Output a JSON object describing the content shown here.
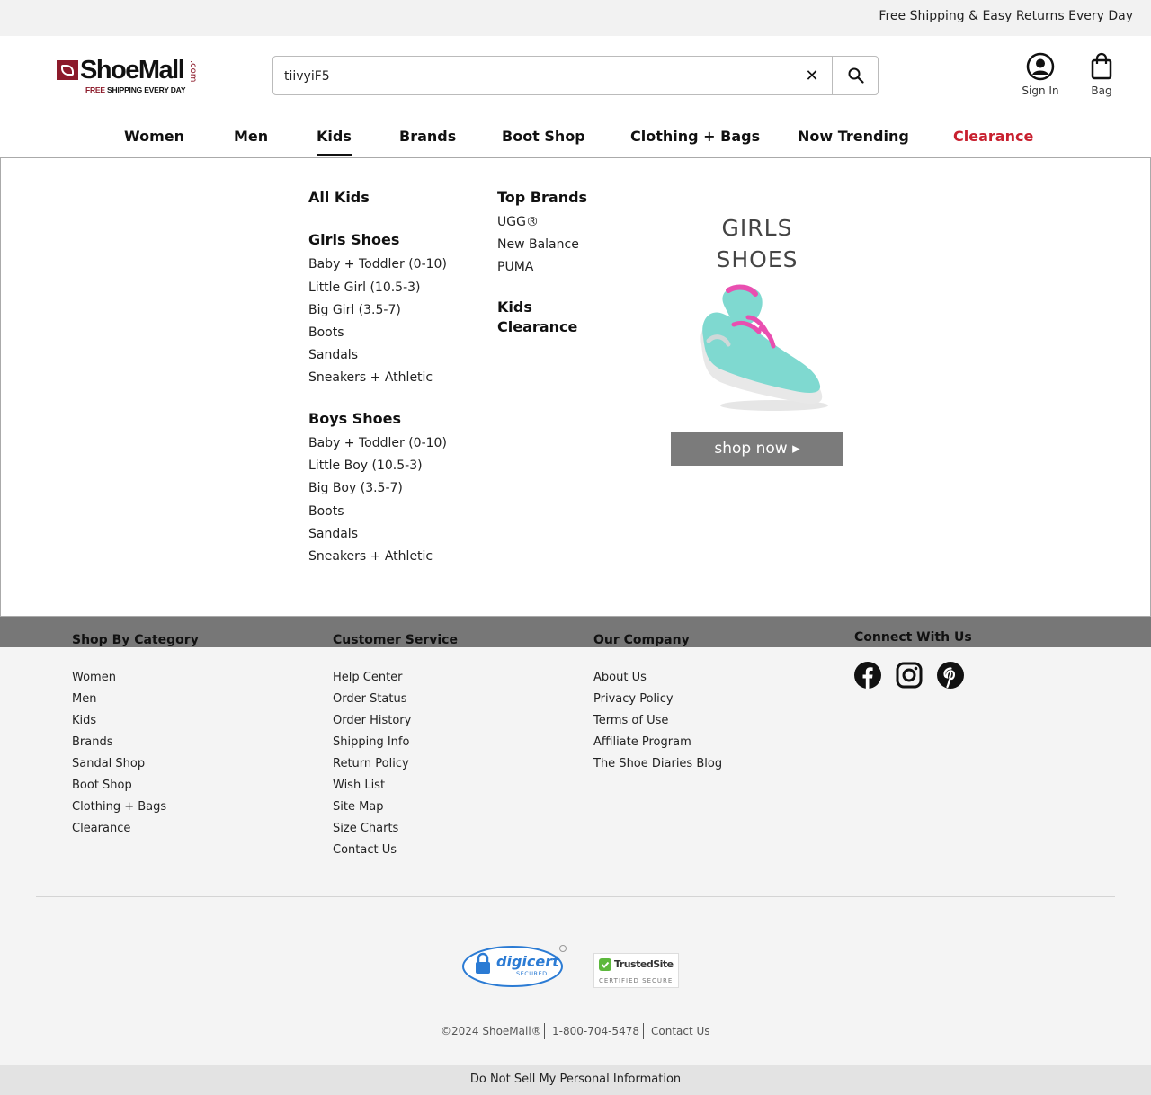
{
  "promo_bar": {
    "text": "Free Shipping & Easy Returns Every Day"
  },
  "header": {
    "logo_name": "ShoeMall",
    "logo_dotcom": ".com",
    "logo_tag_highlight": "FREE",
    "logo_tag_rest": " SHIPPING EVERY DAY",
    "search_value": "tiivyiF5",
    "sign_in_label": "Sign In",
    "bag_label": "Bag"
  },
  "nav": {
    "items": [
      {
        "label": "Women"
      },
      {
        "label": "Men"
      },
      {
        "label": "Kids",
        "active": true
      },
      {
        "label": "Brands"
      },
      {
        "label": "Boot Shop"
      },
      {
        "label": "Clothing + Bags"
      },
      {
        "label": "Now Trending"
      },
      {
        "label": "Clearance",
        "color": "#c8202f"
      }
    ]
  },
  "mega_menu": {
    "all_kids": "All Kids",
    "girls_heading": "Girls Shoes",
    "girls_links": [
      "Baby + Toddler (0-10)",
      "Little Girl (10.5-3)",
      "Big Girl (3.5-7)",
      "Boots",
      "Sandals",
      "Sneakers + Athletic"
    ],
    "boys_heading": "Boys Shoes",
    "boys_links": [
      "Baby + Toddler (0-10)",
      "Little Boy (10.5-3)",
      "Big Boy (3.5-7)",
      "Boots",
      "Sandals",
      "Sneakers + Athletic"
    ],
    "brands_heading": "Top Brands",
    "brand_links": [
      "UGG®",
      "New Balance",
      "PUMA"
    ],
    "clearance_line1": "Kids",
    "clearance_line2": "Clearance",
    "promo_title_line1": "GIRLS",
    "promo_title_line2": "SHOES",
    "promo_button": "shop now ▸",
    "accent_color": "#7b7b7b"
  },
  "footer": {
    "shop_by_category": {
      "heading": "Shop By Category",
      "links": [
        "Women",
        "Men",
        "Kids",
        "Brands",
        "Sandal Shop",
        "Boot Shop",
        "Clothing + Bags",
        "Clearance"
      ]
    },
    "customer_service": {
      "heading": "Customer Service",
      "links": [
        "Help Center",
        "Order Status",
        "Order History",
        "Shipping Info",
        "Return Policy",
        "Wish List",
        "Site Map",
        "Size Charts",
        "Contact Us"
      ]
    },
    "our_company": {
      "heading": "Our Company",
      "links": [
        "About Us",
        "Privacy Policy",
        "Terms of Use",
        "Affiliate Program",
        "The Shoe Diaries Blog"
      ]
    },
    "connect": {
      "heading": "Connect With Us",
      "icons": [
        "facebook-icon",
        "instagram-icon",
        "pinterest-icon"
      ]
    },
    "badges": {
      "digicert_name": "digicert",
      "digicert_sub": "SECURED",
      "trusted_name": "TrustedSite",
      "trusted_sub": "CERTIFIED SECURE"
    },
    "legal": {
      "copyright": "©2024 ShoeMall®",
      "phone": "1-800-704-5478",
      "contact": "Contact Us"
    },
    "do_not_sell": "Do Not Sell My Personal Information"
  }
}
